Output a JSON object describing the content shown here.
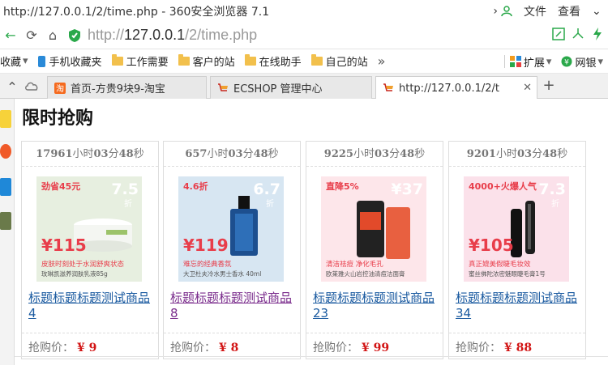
{
  "window": {
    "title": "http://127.0.0.1/2/time.php - 360安全浏览器 7.1",
    "menu": [
      "文件",
      "查看"
    ]
  },
  "addressbar": {
    "url_scheme": "http://",
    "url_host": "127.0.0.1",
    "url_path": "/2/time.php"
  },
  "bookmarks": {
    "items": [
      "收藏",
      "手机收藏夹",
      "工作需要",
      "客户的站",
      "在线助手",
      "自己的站"
    ],
    "more": "»",
    "extensions_label": "扩展",
    "netbank_label": "网银"
  },
  "tabs": [
    {
      "label": "首页-方贵9块9-淘宝",
      "active": false
    },
    {
      "label": "ECSHOP 管理中心",
      "active": false
    },
    {
      "label": "http://127.0.0.1/2/t",
      "active": true
    }
  ],
  "page": {
    "title": "限时抢购",
    "price_label": "抢购价：",
    "products": [
      {
        "timer_hours": "17961",
        "timer_mins": "03",
        "timer_secs": "48",
        "h_unit": "小时",
        "m_unit": "分",
        "s_unit": "秒",
        "name": "标题标题标题测试商品4",
        "price": "¥ 9",
        "visited": false,
        "banner": {
          "top": "劲省45元",
          "discount": "7.5",
          "zhe": "折",
          "price": "¥115",
          "line1": "皮肤时刻处于水润舒爽状态",
          "line2": "玫琳凯滋养润肤乳液85g",
          "color": "#e83d4a",
          "bg": "#e7efe0"
        }
      },
      {
        "timer_hours": "657",
        "timer_mins": "03",
        "timer_secs": "48",
        "h_unit": "小时",
        "m_unit": "分",
        "s_unit": "秒",
        "name": "标题标题标题测试商品8",
        "price": "¥ 8",
        "visited": true,
        "banner": {
          "top": "4.6折",
          "discount": "6.7",
          "zhe": "折",
          "price": "¥119",
          "line1": "难忘的经典香氛",
          "line2": "大卫杜夫冷水男士香水 40ml",
          "color": "#e83d4a",
          "bg": "#d7e6f2"
        }
      },
      {
        "timer_hours": "9225",
        "timer_mins": "03",
        "timer_secs": "48",
        "h_unit": "小时",
        "m_unit": "分",
        "s_unit": "秒",
        "name": "标题标题标题测试商品23",
        "price": "¥ 99",
        "visited": false,
        "banner": {
          "top": "直降5%",
          "discount": "¥37",
          "zhe": "",
          "price": "",
          "line1": "清洁祛痘 净化毛孔",
          "line2": "欧莱雅火山岩控油清痘洁面膏",
          "color": "#e83d4a",
          "bg": "#fde6ea"
        }
      },
      {
        "timer_hours": "9201",
        "timer_mins": "03",
        "timer_secs": "48",
        "h_unit": "小时",
        "m_unit": "分",
        "s_unit": "秒",
        "name": "标题标题标题测试商品34",
        "price": "¥ 88",
        "visited": false,
        "banner": {
          "top": "4000+火爆人气",
          "discount": "7.3",
          "zhe": "折",
          "price": "¥105",
          "line1": "真正媲美假睫毛妆效",
          "line2": "蜜丝佛陀浓密魅眼睫毛膏1号",
          "color": "#e83d4a",
          "bg": "#fbe1ea"
        }
      }
    ]
  }
}
